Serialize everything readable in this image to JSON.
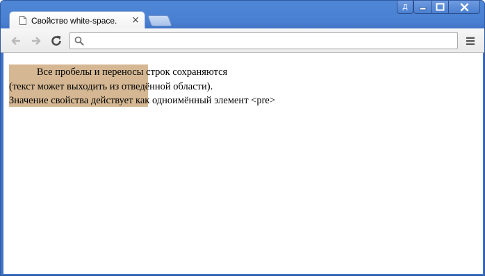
{
  "window": {
    "user_label": "Д"
  },
  "tab": {
    "title": "Свойство white-space.",
    "close_glyph": "×"
  },
  "toolbar": {
    "omnibox_value": "",
    "icons": [
      "back-arrow-icon",
      "forward-arrow-icon",
      "reload-icon",
      "search-icon",
      "menu-icon"
    ]
  },
  "content": {
    "demo_text": "           Все пробелы и переносы строк сохраняются\n(текст может выходить из отведённой области).\nЗначение свойства действует как одноимённый элемент <pre>",
    "box_color": "#d5b893"
  }
}
